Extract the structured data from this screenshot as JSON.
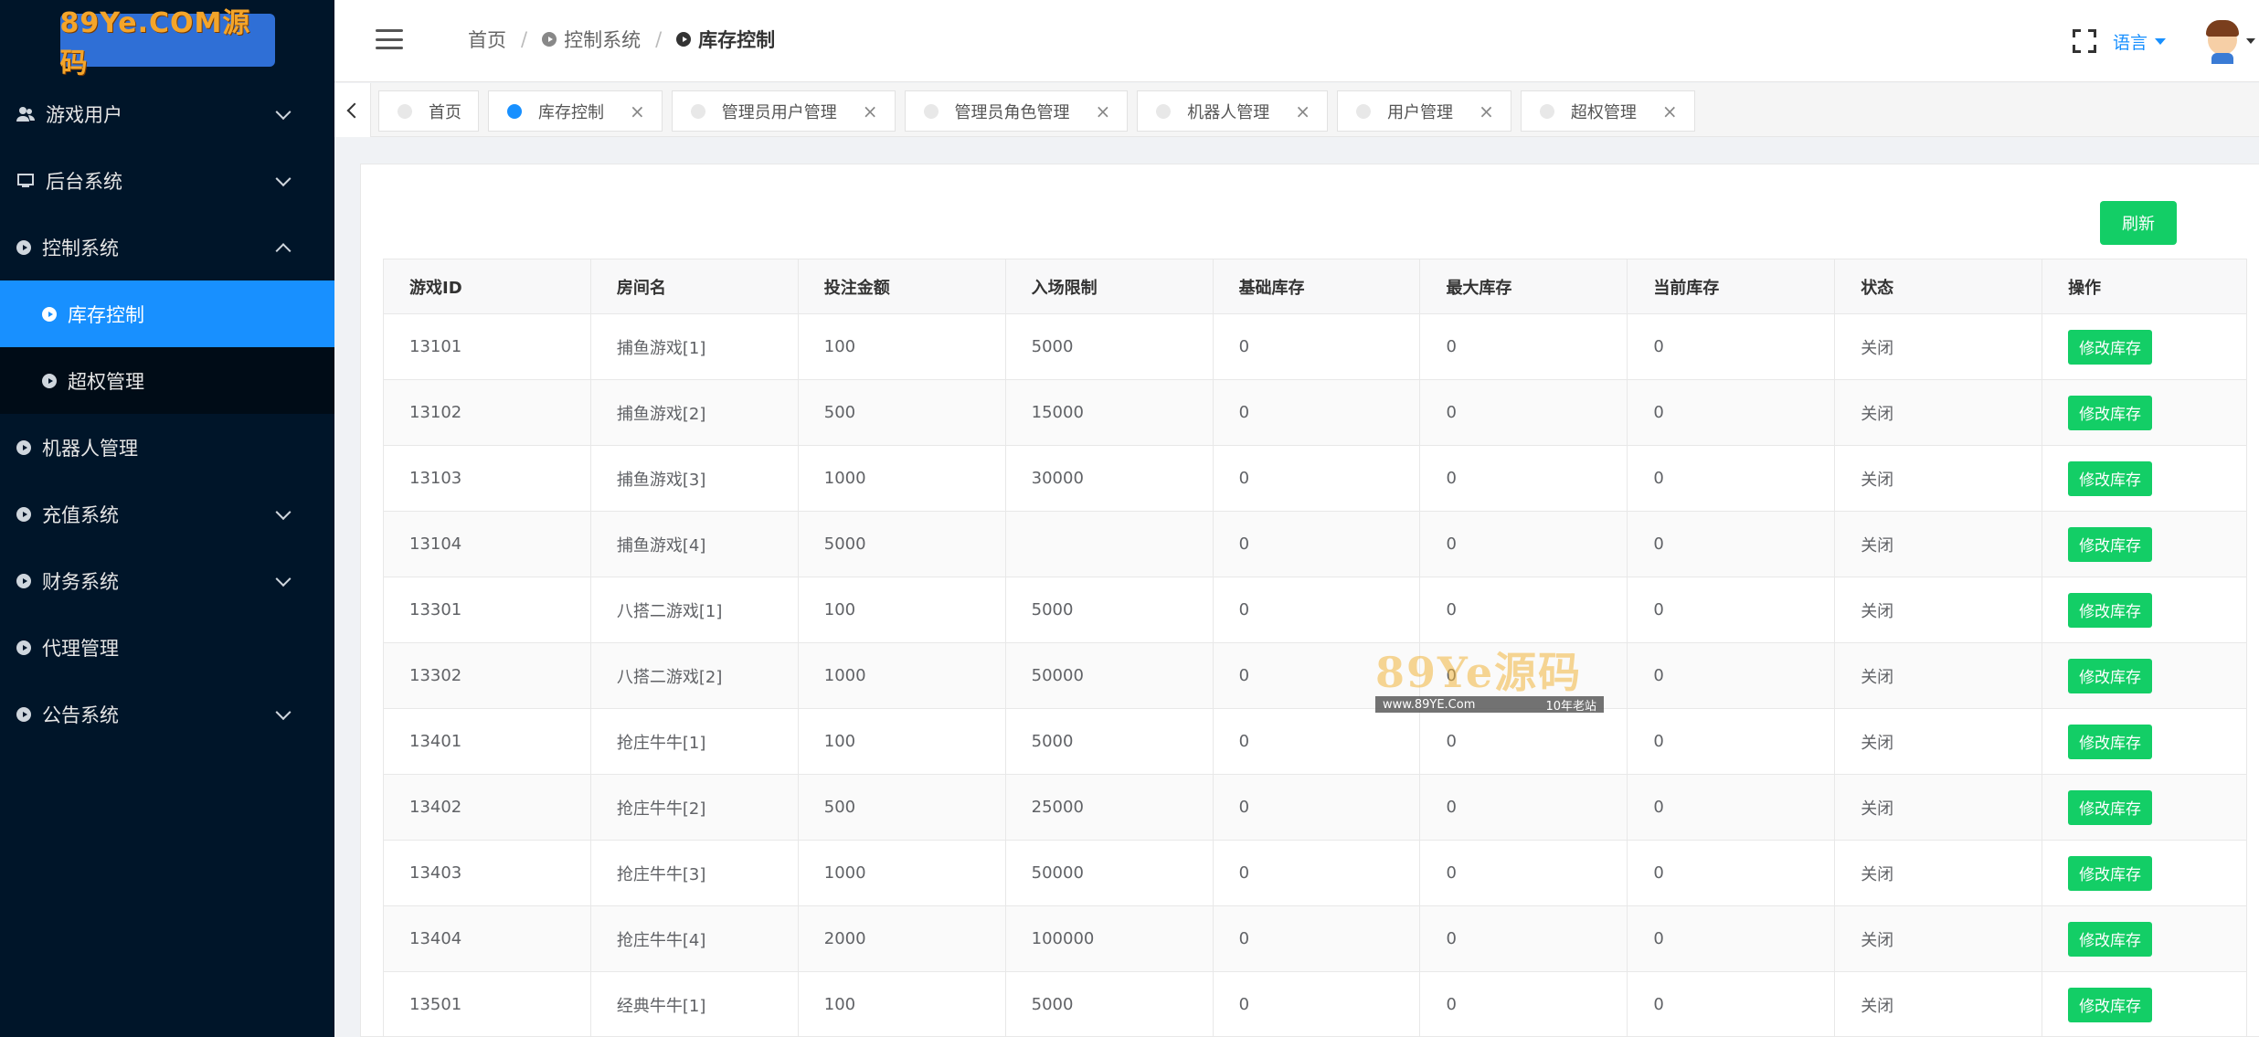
{
  "logo": {
    "text": "89Ye.COM源码"
  },
  "sidebar": {
    "items": [
      {
        "label": "游戏用户",
        "icon": "users-icon",
        "expandable": true,
        "expanded": false
      },
      {
        "label": "后台系统",
        "icon": "monitor-icon",
        "expandable": true,
        "expanded": false
      },
      {
        "label": "控制系统",
        "icon": "play-circle-icon",
        "expandable": true,
        "expanded": true
      },
      {
        "label": "机器人管理",
        "icon": "play-circle-icon",
        "expandable": false
      },
      {
        "label": "充值系统",
        "icon": "play-circle-icon",
        "expandable": true,
        "expanded": false
      },
      {
        "label": "财务系统",
        "icon": "play-circle-icon",
        "expandable": true,
        "expanded": false
      },
      {
        "label": "代理管理",
        "icon": "play-circle-icon",
        "expandable": false
      },
      {
        "label": "公告系统",
        "icon": "play-circle-icon",
        "expandable": true,
        "expanded": false
      }
    ],
    "submenu": [
      {
        "label": "库存控制",
        "active": true
      },
      {
        "label": "超权管理",
        "active": false
      }
    ]
  },
  "header": {
    "breadcrumb": [
      {
        "label": "首页"
      },
      {
        "label": "控制系统"
      },
      {
        "label": "库存控制"
      }
    ],
    "language_label": "语言"
  },
  "tabs": [
    {
      "label": "首页",
      "active": false,
      "closable": false
    },
    {
      "label": "库存控制",
      "active": true,
      "closable": true
    },
    {
      "label": "管理员用户管理",
      "active": false,
      "closable": true
    },
    {
      "label": "管理员角色管理",
      "active": false,
      "closable": true
    },
    {
      "label": "机器人管理",
      "active": false,
      "closable": true
    },
    {
      "label": "用户管理",
      "active": false,
      "closable": true
    },
    {
      "label": "超权管理",
      "active": false,
      "closable": true
    }
  ],
  "content": {
    "refresh_label": "刷新",
    "table": {
      "columns": [
        "游戏ID",
        "房间名",
        "投注金额",
        "入场限制",
        "基础库存",
        "最大库存",
        "当前库存",
        "状态",
        "操作"
      ],
      "action_label": "修改库存",
      "rows": [
        [
          "13101",
          "捕鱼游戏[1]",
          "100",
          "5000",
          "0",
          "0",
          "0",
          "关闭"
        ],
        [
          "13102",
          "捕鱼游戏[2]",
          "500",
          "15000",
          "0",
          "0",
          "0",
          "关闭"
        ],
        [
          "13103",
          "捕鱼游戏[3]",
          "1000",
          "30000",
          "0",
          "0",
          "0",
          "关闭"
        ],
        [
          "13104",
          "捕鱼游戏[4]",
          "5000",
          "",
          "0",
          "0",
          "0",
          "关闭"
        ],
        [
          "13301",
          "八搭二游戏[1]",
          "100",
          "5000",
          "0",
          "0",
          "0",
          "关闭"
        ],
        [
          "13302",
          "八搭二游戏[2]",
          "1000",
          "50000",
          "0",
          "0",
          "0",
          "关闭"
        ],
        [
          "13401",
          "抢庄牛牛[1]",
          "100",
          "5000",
          "0",
          "0",
          "0",
          "关闭"
        ],
        [
          "13402",
          "抢庄牛牛[2]",
          "500",
          "25000",
          "0",
          "0",
          "0",
          "关闭"
        ],
        [
          "13403",
          "抢庄牛牛[3]",
          "1000",
          "50000",
          "0",
          "0",
          "0",
          "关闭"
        ],
        [
          "13404",
          "抢庄牛牛[4]",
          "2000",
          "100000",
          "0",
          "0",
          "0",
          "关闭"
        ],
        [
          "13501",
          "经典牛牛[1]",
          "100",
          "5000",
          "0",
          "0",
          "0",
          "关闭"
        ]
      ]
    }
  },
  "watermark": {
    "title": "89Ye源码",
    "url": "www.89YE.Com",
    "tagline": "10年老站"
  },
  "colors": {
    "sidebar_bg": "#001529",
    "active_blue": "#1890ff",
    "button_green": "#13ce66",
    "status_orange": "#e6a23c"
  }
}
